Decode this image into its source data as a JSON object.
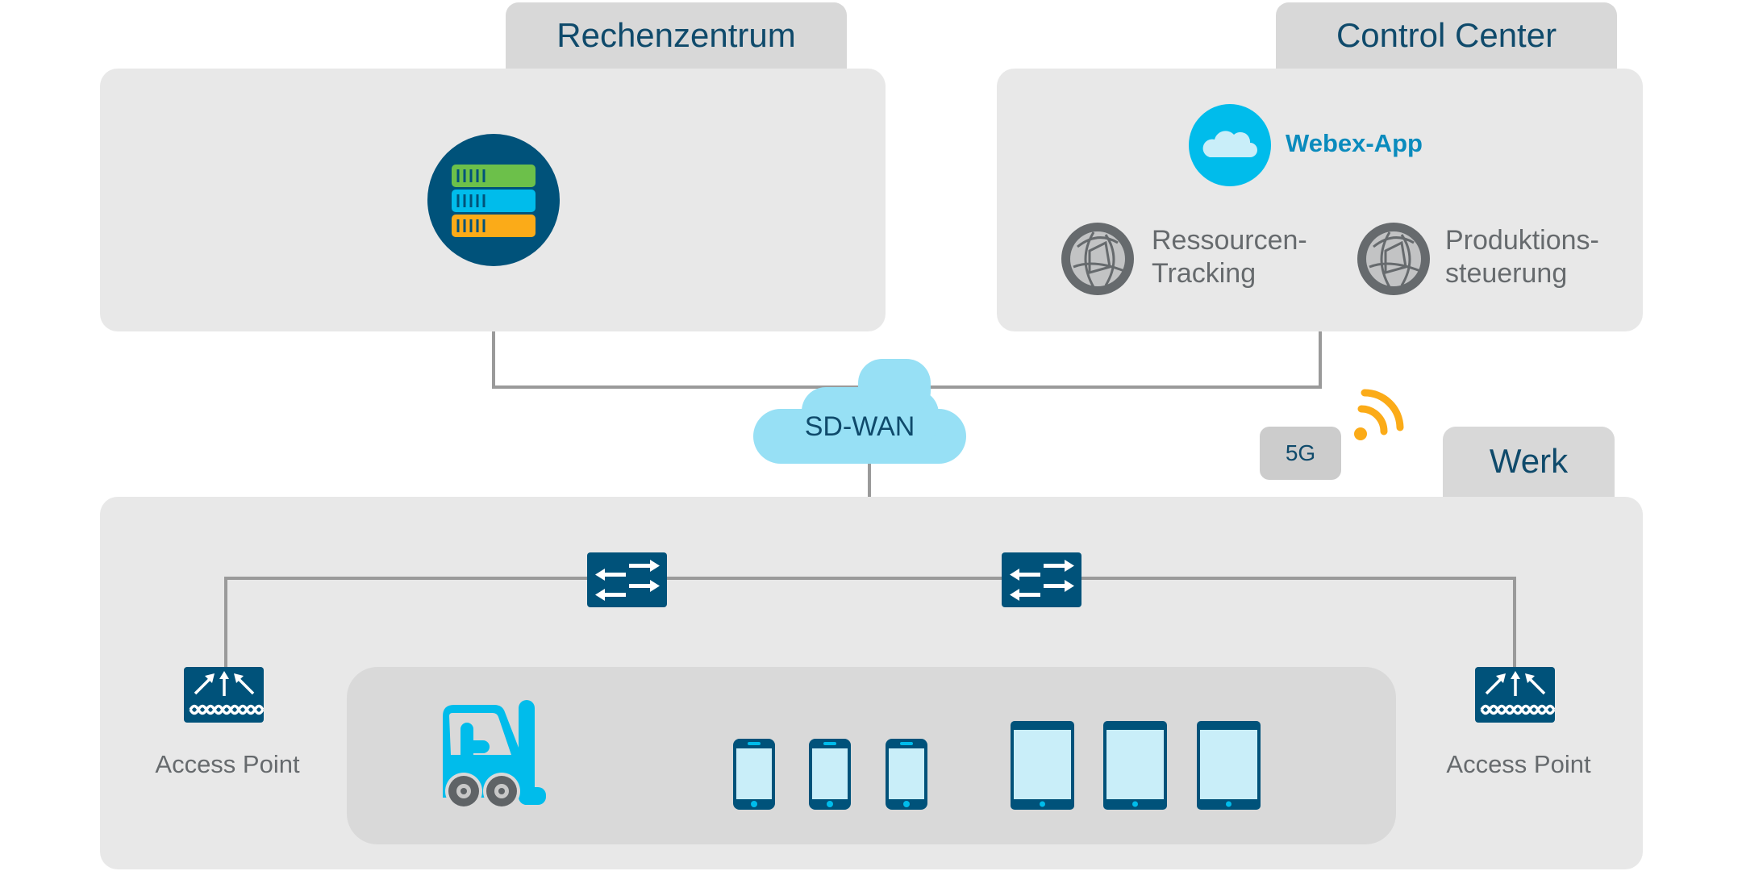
{
  "datacenter": {
    "title": "Rechenzentrum",
    "icon": "server-stack-icon"
  },
  "control_center": {
    "title": "Control Center",
    "webex": {
      "label": "Webex-App",
      "icon": "cloud-icon"
    },
    "apps": [
      {
        "line1": "Ressourcen-",
        "line2": "Tracking",
        "icon": "globe-network-icon"
      },
      {
        "line1": "Produktions-",
        "line2": "steuerung",
        "icon": "globe-network-icon"
      }
    ]
  },
  "network": {
    "sdwan_label": "SD-WAN",
    "cellular_label": "5G"
  },
  "plant": {
    "title": "Werk",
    "access_points": [
      {
        "label": "Access Point"
      },
      {
        "label": "Access Point"
      }
    ],
    "devices": {
      "forklift": 1,
      "phones": 3,
      "tablets": 3
    }
  },
  "colors": {
    "navy": "#00527a",
    "cyan": "#00bceb",
    "orange": "#fbab18",
    "green": "#6cc04a",
    "panel": "#e8e8e8",
    "line": "#9a9a9a"
  }
}
